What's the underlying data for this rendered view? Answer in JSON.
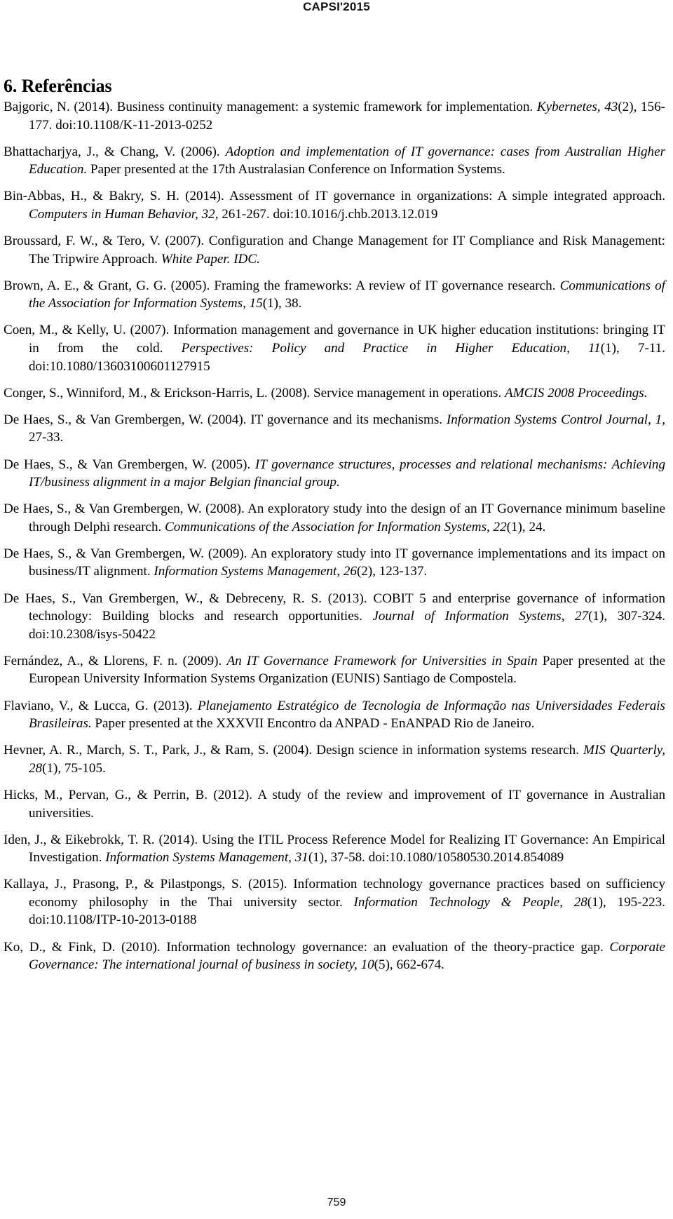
{
  "header": {
    "running_title": "CAPSI'2015"
  },
  "section": {
    "number_and_title": "6. Referências"
  },
  "footer": {
    "page_number": "759"
  },
  "references": [
    {
      "id": "bajgoric-2014",
      "html": "Bajgoric, N. (2014). Business continuity management: a systemic framework for implementation. <i>Kybernetes, 43</i>(2), 156-177. doi:10.1108/K-11-2013-0252"
    },
    {
      "id": "bhattacharjya-chang-2006",
      "html": "Bhattacharjya, J., &amp; Chang, V. (2006). <i>Adoption and implementation of IT governance: cases from Australian Higher Education.</i> Paper presented at the 17th Australasian Conference on Information Systems."
    },
    {
      "id": "bin-abbas-bakry-2014",
      "html": "Bin-Abbas, H., &amp; Bakry, S. H. (2014). Assessment of IT governance in organizations: A simple integrated approach. <i>Computers in Human Behavior, 32,</i> 261-267. doi:10.1016/j.chb.2013.12.019"
    },
    {
      "id": "broussard-tero-2007",
      "html": "Broussard, F. W., &amp; Tero, V. (2007). Configuration and Change Management for IT Compliance and Risk Management: The Tripwire Approach. <i>White Paper. IDC.</i>"
    },
    {
      "id": "brown-grant-2005",
      "html": "Brown, A. E., &amp; Grant, G. G. (2005). Framing the frameworks: A review of IT governance research. <i>Communications of the Association for Information Systems, 15</i>(1), 38."
    },
    {
      "id": "coen-kelly-2007",
      "html": "Coen, M., &amp; Kelly, U. (2007). Information management and governance in UK higher education institutions: bringing IT in from the cold. <i>Perspectives: Policy and Practice in Higher Education, 11</i>(1), 7-11. doi:10.1080/13603100601127915"
    },
    {
      "id": "conger-winniford-erickson-harris-2008",
      "html": "Conger, S., Winniford, M., &amp; Erickson-Harris, L. (2008). Service management in operations. <i>AMCIS 2008 Proceedings.</i>"
    },
    {
      "id": "de-haes-van-grembergen-2004",
      "html": "De Haes, S., &amp; Van Grembergen, W. (2004). IT governance and its mechanisms. <i>Information Systems Control Journal, 1,</i> 27-33."
    },
    {
      "id": "de-haes-van-grembergen-2005",
      "html": "De Haes, S., &amp; Van Grembergen, W. (2005). <i>IT governance structures, processes and relational mechanisms: Achieving IT/business alignment in a major Belgian financial group.</i>"
    },
    {
      "id": "de-haes-van-grembergen-2008",
      "html": "De Haes, S., &amp; Van Grembergen, W. (2008). An exploratory study into the design of an IT Governance minimum baseline through Delphi research. <i>Communications of the Association for Information Systems, 22</i>(1), 24."
    },
    {
      "id": "de-haes-van-grembergen-2009",
      "html": "De Haes, S., &amp; Van Grembergen, W. (2009). An exploratory study into IT governance implementations and its impact on business/IT alignment. <i>Information Systems Management, 26</i>(2), 123-137."
    },
    {
      "id": "de-haes-van-grembergen-debreceny-2013",
      "html": "De Haes, S., Van Grembergen, W., &amp; Debreceny, R. S. (2013). COBIT 5 and enterprise governance of information technology: Building blocks and research opportunities. <i>Journal of Information Systems, 27</i>(1), 307-324. doi:10.2308/isys-50422"
    },
    {
      "id": "fernandez-llorens-2009",
      "html": "Fernández, A., &amp; Llorens, F. n. (2009). <i>An IT Governance Framework for Universities in Spain</i> Paper presented at the European University Information Systems Organization (EUNIS) Santiago de Compostela."
    },
    {
      "id": "flaviano-lucca-2013",
      "html": "Flaviano, V., &amp; Lucca, G. (2013). <i>Planejamento Estratégico de Tecnologia de Informação nas Universidades Federais Brasileiras.</i> Paper presented at the XXXVII Encontro da ANPAD - EnANPAD Rio de Janeiro."
    },
    {
      "id": "hevner-march-park-ram-2004",
      "html": "Hevner, A. R., March, S. T., Park, J., &amp; Ram, S. (2004). Design science in information systems research. <i>MIS Quarterly, 28</i>(1), 75-105."
    },
    {
      "id": "hicks-pervan-perrin-2012",
      "html": "Hicks, M., Pervan, G., &amp; Perrin, B. (2012). A study of the review and improvement of IT governance in Australian universities."
    },
    {
      "id": "iden-eikebrokk-2014",
      "html": "Iden, J., &amp; Eikebrokk, T. R. (2014). Using the ITIL Process Reference Model for Realizing IT Governance: An Empirical Investigation. <i>Information Systems Management, 31</i>(1), 37-58. doi:10.1080/10580530.2014.854089"
    },
    {
      "id": "kallaya-prasong-pilastpongs-2015",
      "html": "Kallaya, J., Prasong, P., &amp; Pilastpongs, S. (2015). Information technology governance practices based on sufficiency economy philosophy in the Thai university sector. <i>Information Technology &amp; People, 28</i>(1), 195-223. doi:10.1108/ITP-10-2013-0188"
    },
    {
      "id": "ko-fink-2010",
      "html": "Ko, D., &amp; Fink, D. (2010). Information technology governance: an evaluation of the theory-practice gap. <i>Corporate Governance: The international journal of business in society, 10</i>(5), 662-674."
    }
  ]
}
